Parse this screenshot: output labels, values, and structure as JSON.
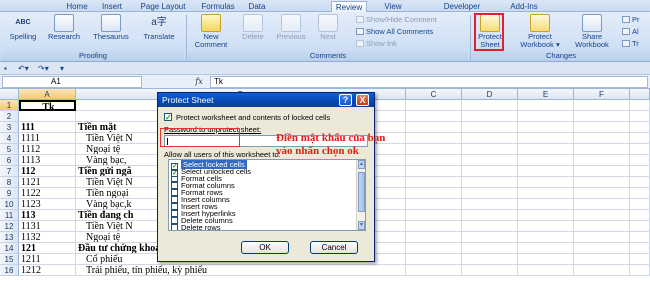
{
  "tabs": [
    "Home",
    "Insert",
    "Page Layout",
    "Formulas",
    "Data",
    "Review",
    "View",
    "Developer",
    "Add-Ins"
  ],
  "active_tab": "Review",
  "ribbon": {
    "proofing": {
      "label": "Proofing",
      "spelling": "Spelling",
      "research": "Research",
      "thesaurus": "Thesaurus",
      "translate": "Translate",
      "abc_glyph": "ABC",
      "translate_glyph": "a字"
    },
    "comments": {
      "label": "Comments",
      "new_comment_line1": "New",
      "new_comment_line2": "Comment",
      "delete": "Delete",
      "previous": "Previous",
      "next": "Next",
      "show_hide": "Show/Hide Comment",
      "show_all": "Show All Comments",
      "show_ink": "Show Ink"
    },
    "changes": {
      "label": "Changes",
      "protect_sheet_line1": "Protect",
      "protect_sheet_line2": "Sheet",
      "protect_workbook_line1": "Protect",
      "protect_workbook_line2": "Workbook",
      "share_workbook_line1": "Share",
      "share_workbook_line2": "Workbook",
      "pr_1": "Pr",
      "pr_2": "Al",
      "pr_3": "Tr"
    }
  },
  "formula_bar": {
    "name_box": "A1",
    "fx": "fx",
    "value": "Tk"
  },
  "columns": [
    "A",
    "B",
    "C",
    "D",
    "E",
    "F"
  ],
  "rows": [
    {
      "num": "1",
      "a": "Tk",
      "b": ""
    },
    {
      "num": "2",
      "a": "",
      "b": ""
    },
    {
      "num": "3",
      "a": "111",
      "b": "Tiền mặt"
    },
    {
      "num": "4",
      "a": "1111",
      "b": "Tiền Việt N"
    },
    {
      "num": "5",
      "a": "1112",
      "b": "Ngoại tệ"
    },
    {
      "num": "6",
      "a": "1113",
      "b": "Vàng bạc,"
    },
    {
      "num": "7",
      "a": "112",
      "b": "Tiền gửi ngâ"
    },
    {
      "num": "8",
      "a": "1121",
      "b": "Tiền Việt N"
    },
    {
      "num": "9",
      "a": "1122",
      "b": "Tiền ngoại"
    },
    {
      "num": "10",
      "a": "1123",
      "b": "Vàng bạc,k"
    },
    {
      "num": "11",
      "a": "113",
      "b": "Tiền đang ch"
    },
    {
      "num": "12",
      "a": "1131",
      "b": "Tiền Việt N"
    },
    {
      "num": "13",
      "a": "1132",
      "b": "Ngoại tệ"
    },
    {
      "num": "14",
      "a": "121",
      "b": "Đầu tư chứng khoán ngắn hạn"
    },
    {
      "num": "15",
      "a": "1211",
      "b": "Cổ phiếu"
    },
    {
      "num": "16",
      "a": "1212",
      "b": "Trái phiếu, tín phiếu, kỳ phiếu"
    }
  ],
  "dialog": {
    "title": "Protect Sheet",
    "help": "?",
    "close": "X",
    "protect_check": "Protect worksheet and contents of locked cells",
    "password_label": "Password to unprotect sheet:",
    "allow_label": "Allow all users of this worksheet to:",
    "options": [
      {
        "label": "Select locked cells",
        "checked": true
      },
      {
        "label": "Select unlocked cells",
        "checked": true
      },
      {
        "label": "Format cells",
        "checked": false
      },
      {
        "label": "Format columns",
        "checked": false
      },
      {
        "label": "Format rows",
        "checked": false
      },
      {
        "label": "Insert columns",
        "checked": false
      },
      {
        "label": "Insert rows",
        "checked": false
      },
      {
        "label": "Insert hyperlinks",
        "checked": false
      },
      {
        "label": "Delete columns",
        "checked": false
      },
      {
        "label": "Delete rows",
        "checked": false
      }
    ],
    "ok": "OK",
    "cancel": "Cancel"
  },
  "annotation": "Điền mật khẩu của bạn vào nhấn chọn ok",
  "colors": {
    "annotation_red": "#e0201a",
    "title_blue": "#0a4fc8",
    "selection_blue": "#316ac5"
  }
}
